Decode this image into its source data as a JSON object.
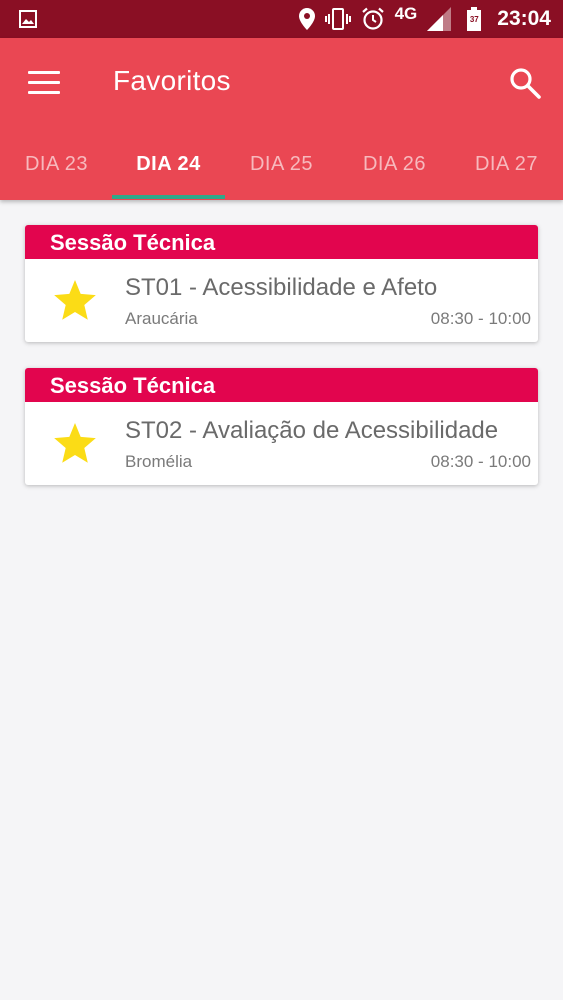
{
  "status_bar": {
    "network": "4G",
    "battery_level": "37",
    "time": "23:04",
    "icons": [
      "gallery-icon",
      "location-icon",
      "vibrate-icon",
      "alarm-icon",
      "signal-icon",
      "battery-icon"
    ]
  },
  "app_bar": {
    "title": "Favoritos",
    "icons": [
      "menu-icon",
      "search-icon"
    ]
  },
  "tabs": [
    {
      "label": "DIA 23",
      "active": false
    },
    {
      "label": "DIA 24",
      "active": true
    },
    {
      "label": "DIA 25",
      "active": false
    },
    {
      "label": "DIA 26",
      "active": false
    },
    {
      "label": "DIA 27",
      "active": false
    }
  ],
  "favorites": [
    {
      "category": "Sessão Técnica",
      "title": "ST01 - Acessibilidade e Afeto",
      "room": "Araucária",
      "time": "08:30 - 10:00"
    },
    {
      "category": "Sessão Técnica",
      "title": "ST02 - Avaliação de Acessibilidade",
      "room": "Bromélia",
      "time": "08:30 - 10:00"
    }
  ],
  "colors": {
    "status_bar": "#8a0f24",
    "app_bar": "#ea4753",
    "card_header": "#e2054e",
    "tab_indicator": "#2fa88a",
    "star": "#fbdc16",
    "background": "#f5f5f7"
  }
}
